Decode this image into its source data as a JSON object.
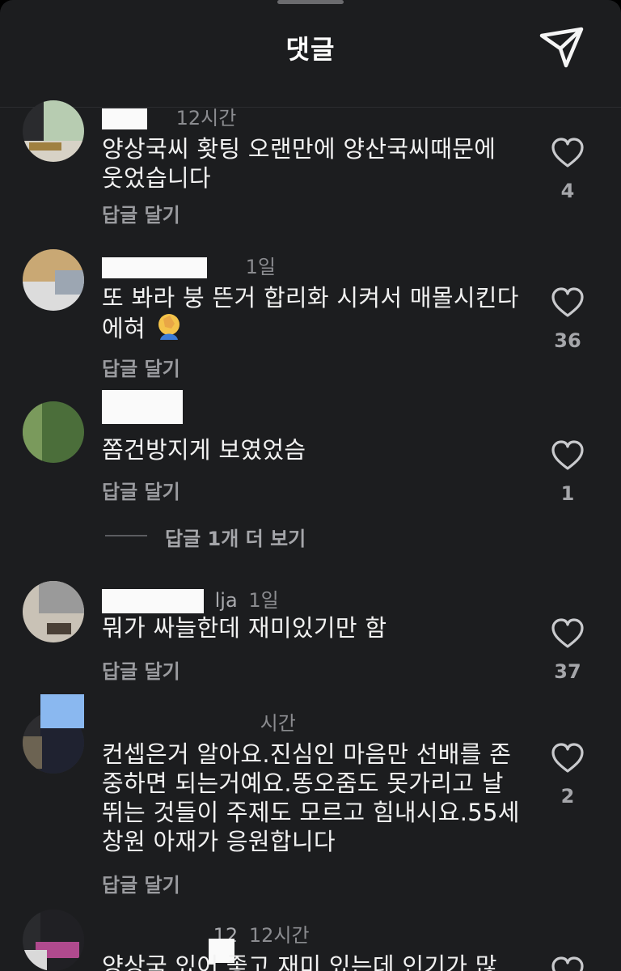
{
  "header": {
    "title": "댓글",
    "share_icon": "send-icon"
  },
  "reply_label": "답글 달기",
  "comments": [
    {
      "username": "",
      "time": "12시간",
      "text": "양상국씨 홧팅 오랜만에 양산국씨때문에 웃었습니다",
      "likes": "4"
    },
    {
      "username": "",
      "time": "1일",
      "text": "또 봐라  붕 뜬거  합리화 시켜서  매몰시킨다 에혀",
      "likes": "36"
    },
    {
      "username": "",
      "time": "",
      "text": "쫌건방지게 보였었슴",
      "likes": "1",
      "more_replies": "답글 1개 더 보기"
    },
    {
      "username": "lja",
      "time": "1일",
      "text": "뭐가 싸늘한데 재미있기만 함",
      "likes": "37"
    },
    {
      "username": "",
      "time": "시간",
      "text": "컨셉은거 알아요.진심인 마음만 선배를 존중하면 되는거예요.똥오줌도 못가리고 날뛰는 것들이 주제도 모르고 힘내시요.55세 창원 아재가 응원합니다",
      "likes": "2"
    },
    {
      "username": "12",
      "time": "12시간",
      "text": "양상국 있어 좋고 재미 있는데 인기가 많",
      "likes": ""
    }
  ],
  "colors": {
    "background": "#1c1d1f",
    "text": "#f2f2f2",
    "muted": "#8b8c90",
    "divider": "#2c2d30"
  }
}
